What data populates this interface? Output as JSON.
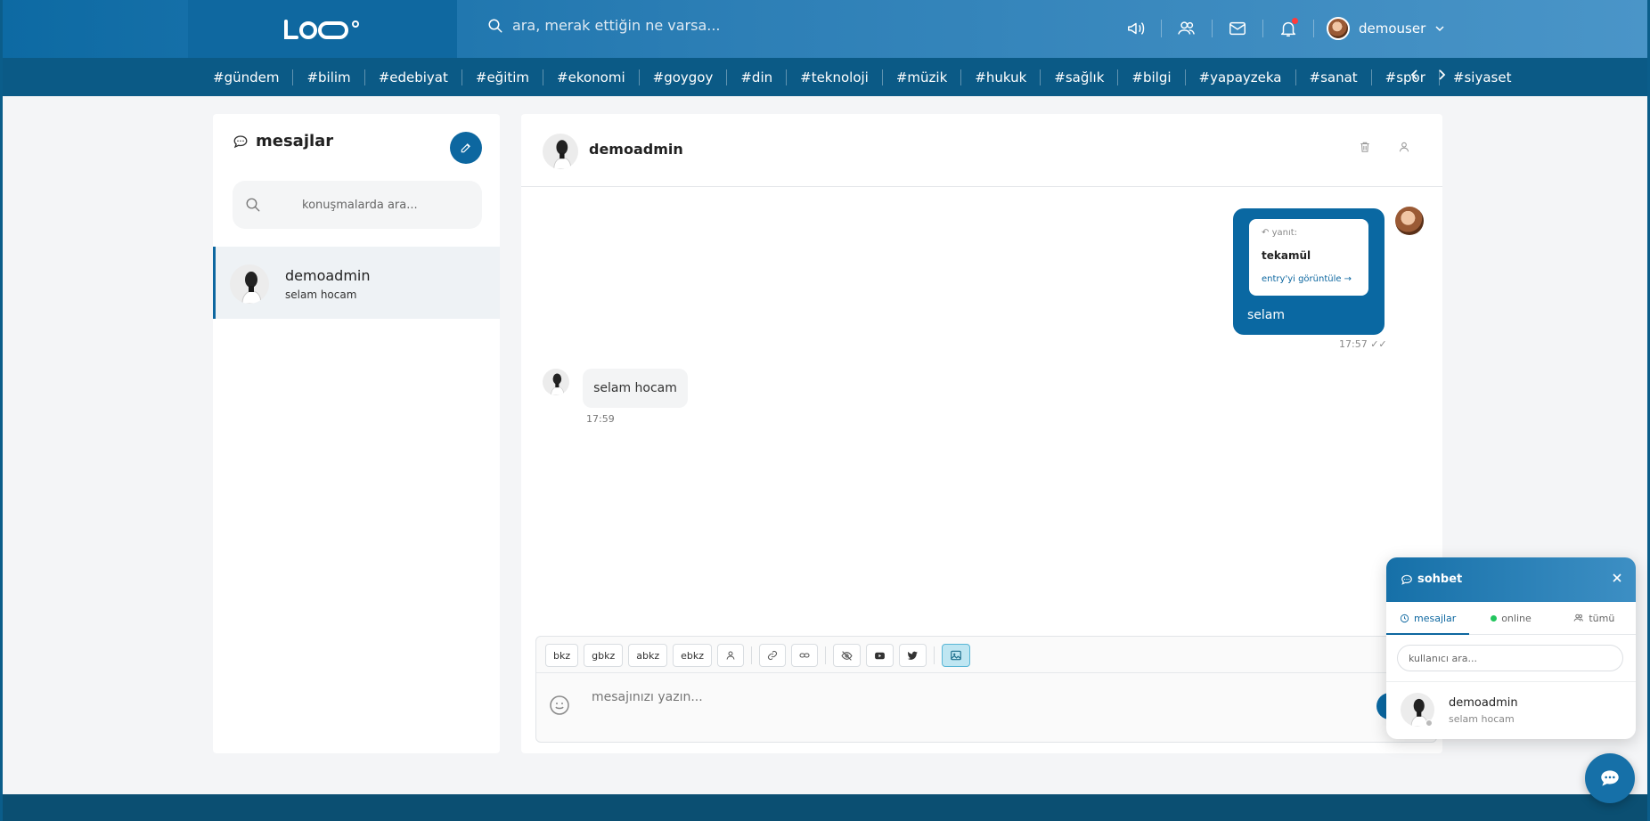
{
  "header": {
    "logo": "LOOO",
    "search_placeholder": "ara, merak ettiğin ne varsa...",
    "user_name": "demouser"
  },
  "tags": [
    "#gündem",
    "#bilim",
    "#edebiyat",
    "#eğitim",
    "#ekonomi",
    "#goygoy",
    "#din",
    "#teknoloji",
    "#müzik",
    "#hukuk",
    "#sağlık",
    "#bilgi",
    "#yapayzeka",
    "#sanat",
    "#spor",
    "#siyaset"
  ],
  "sidebar": {
    "title": "mesajlar",
    "search_placeholder": "konuşmalarda ara...",
    "conversations": [
      {
        "name": "demoadmin",
        "last": "selam hocam"
      }
    ]
  },
  "chat": {
    "contact": "demoadmin",
    "messages": [
      {
        "direction": "out",
        "quote_label": "yanıt:",
        "quote_title": "tekamül",
        "quote_link": "entry'yi görüntüle →",
        "text": "selam",
        "time": "17:57 ✓✓"
      },
      {
        "direction": "in",
        "text": "selam hocam",
        "time": "17:59"
      }
    ],
    "toolbar": [
      "bkz",
      "gbkz",
      "abkz",
      "ebkz"
    ],
    "input_placeholder": "mesajınızı yazın..."
  },
  "widget": {
    "title": "sohbet",
    "tabs": [
      "mesajlar",
      "online",
      "tümü"
    ],
    "search_placeholder": "kullanıcı ara...",
    "item_name": "demoadmin",
    "item_last": "selam hocam"
  },
  "colors": {
    "primary": "#0d67a0",
    "header_dark": "#0b5a86",
    "footer": "#0b4f72"
  }
}
